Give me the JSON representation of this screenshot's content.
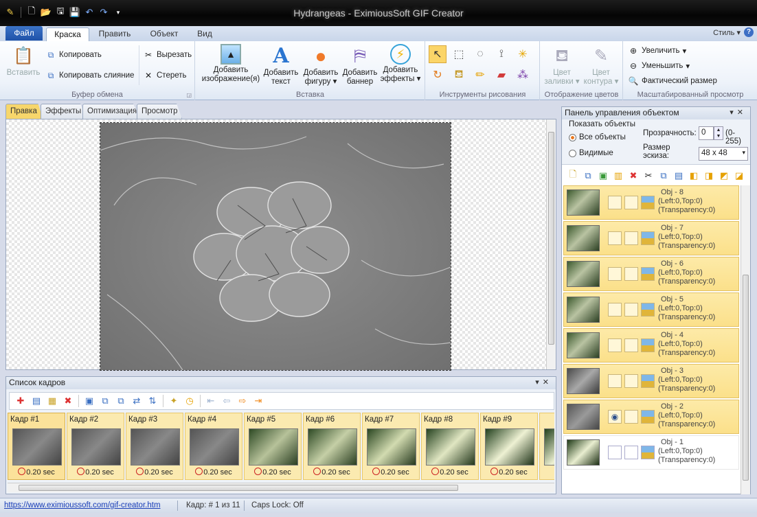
{
  "app": {
    "title": "Hydrangeas - EximiousSoft GIF Creator"
  },
  "menu": {
    "file": "Файл",
    "tabs": [
      "Краска",
      "Править",
      "Объект",
      "Вид"
    ],
    "style": "Стиль",
    "help": "?"
  },
  "ribbon": {
    "clipboard": {
      "paste": "Вставить",
      "copy": "Копировать",
      "copy_merge": "Копировать слияние",
      "cut": "Вырезать",
      "erase": "Стереть",
      "label": "Буфер обмена"
    },
    "insert": {
      "add_image": "Добавить изображение(я)",
      "add_text": "Добавить текст",
      "add_shape": "Добавить фигуру",
      "add_banner": "Добавить баннер",
      "add_effects": "Добавить эффекты",
      "label": "Вставка"
    },
    "drawing": {
      "label": "Инструменты рисования"
    },
    "colors": {
      "fill": "Цвет заливки",
      "outline": "Цвет контура",
      "label": "Отображение цветов"
    },
    "zoom": {
      "in": "Увеличить",
      "out": "Уменьшить",
      "actual": "Фактический размер",
      "label": "Масштабированный просмотр"
    }
  },
  "doc_tabs": [
    "Правка",
    "Эффекты",
    "Оптимизация",
    "Просмотр"
  ],
  "frames": {
    "title": "Список кадров",
    "items": [
      {
        "name": "Кадр #1",
        "time": "0.20 sec"
      },
      {
        "name": "Кадр #2",
        "time": "0.20 sec"
      },
      {
        "name": "Кадр #3",
        "time": "0.20 sec"
      },
      {
        "name": "Кадр #4",
        "time": "0.20 sec"
      },
      {
        "name": "Кадр #5",
        "time": "0.20 sec"
      },
      {
        "name": "Кадр #6",
        "time": "0.20 sec"
      },
      {
        "name": "Кадр #7",
        "time": "0.20 sec"
      },
      {
        "name": "Кадр #8",
        "time": "0.20 sec"
      },
      {
        "name": "Кадр #9",
        "time": "0.20 sec"
      }
    ]
  },
  "objects": {
    "title": "Панель управления объектом",
    "show_label": "Показать объекты",
    "all": "Все объекты",
    "visible": "Видимые",
    "transparency_label": "Прозрачность:",
    "transparency_value": "0",
    "transparency_range": "(0-255)",
    "thumb_label": "Размер эскиза:",
    "thumb_value": "48 x 48",
    "items": [
      {
        "name": "Obj - 8",
        "pos": "(Left:0,Top:0)",
        "trans": "(Transparency:0)"
      },
      {
        "name": "Obj - 7",
        "pos": "(Left:0,Top:0)",
        "trans": "(Transparency:0)"
      },
      {
        "name": "Obj - 6",
        "pos": "(Left:0,Top:0)",
        "trans": "(Transparency:0)"
      },
      {
        "name": "Obj - 5",
        "pos": "(Left:0,Top:0)",
        "trans": "(Transparency:0)"
      },
      {
        "name": "Obj - 4",
        "pos": "(Left:0,Top:0)",
        "trans": "(Transparency:0)"
      },
      {
        "name": "Obj - 3",
        "pos": "(Left:0,Top:0)",
        "trans": "(Transparency:0)"
      },
      {
        "name": "Obj - 2",
        "pos": "(Left:0,Top:0)",
        "trans": "(Transparency:0)"
      },
      {
        "name": "Obj - 1",
        "pos": "(Left:0,Top:0)",
        "trans": "(Transparency:0)"
      }
    ]
  },
  "status": {
    "url": "https://www.eximioussoft.com/gif-creator.htm",
    "frame": "Кадр: # 1 из 11",
    "caps": "Caps Lock: Off"
  }
}
